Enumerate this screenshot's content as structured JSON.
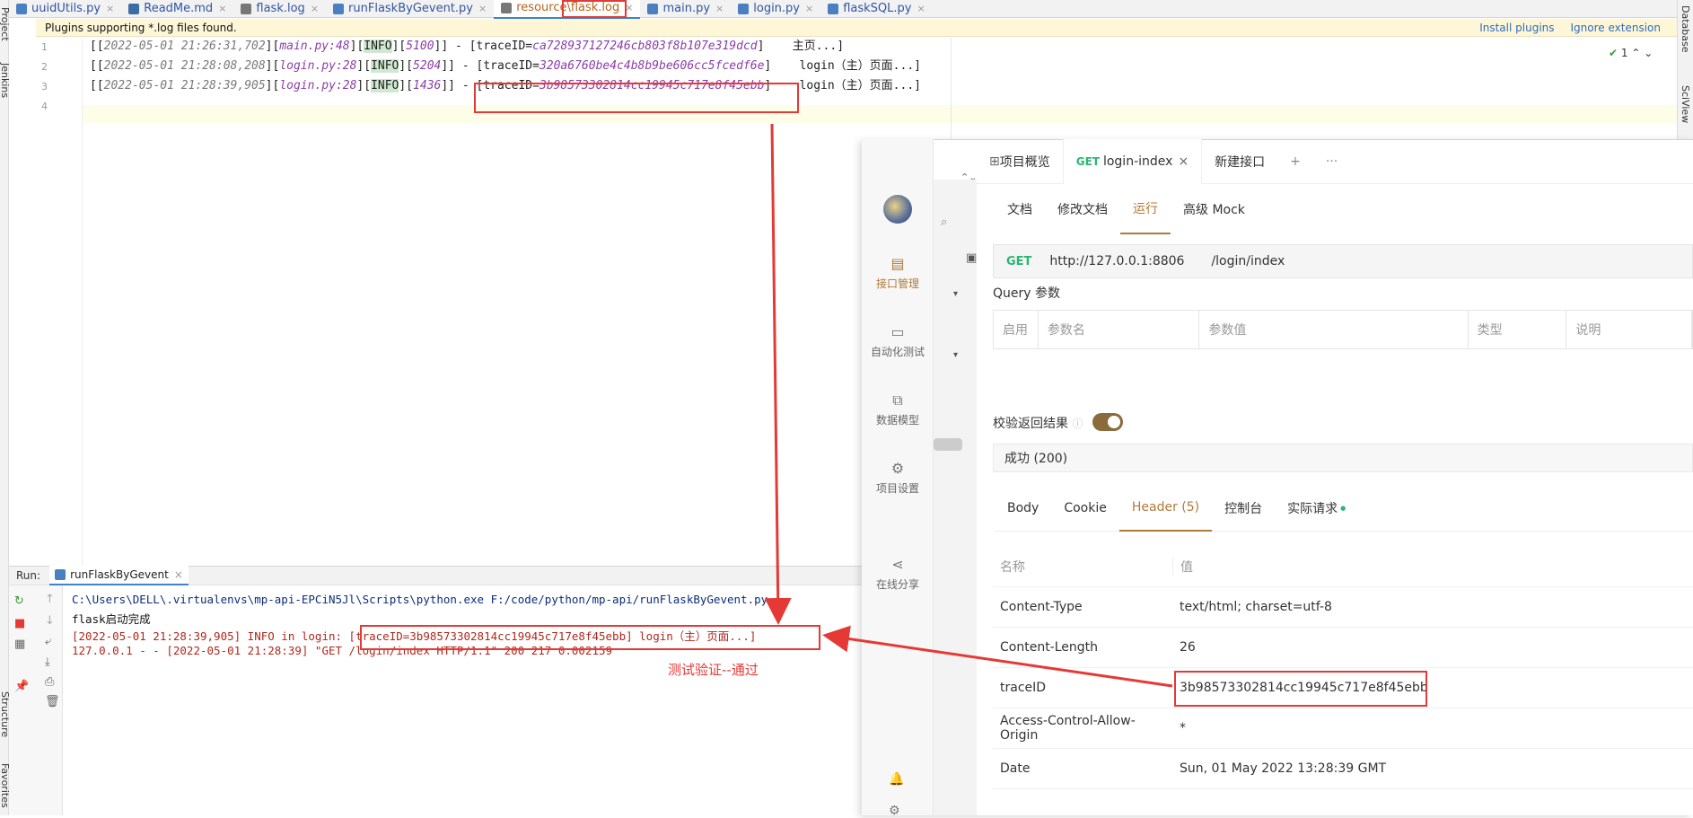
{
  "ide": {
    "tabs": [
      {
        "label": "uuidUtils.py",
        "color": "#4a7fc1",
        "active": false
      },
      {
        "label": "ReadMe.md",
        "color": "#3a6ea5",
        "active": false
      },
      {
        "label": "flask.log",
        "color": "#777777",
        "active": false
      },
      {
        "label": "runFlaskByGevent.py",
        "color": "#4a7fc1",
        "active": false
      },
      {
        "label": "resource\\flask.log",
        "color": "#777777",
        "active": true
      },
      {
        "label": "main.py",
        "color": "#4a7fc1",
        "active": false
      },
      {
        "label": "login.py",
        "color": "#4a7fc1",
        "active": false
      },
      {
        "label": "flaskSQL.py",
        "color": "#4a7fc1",
        "active": false
      }
    ],
    "banner": {
      "text": "Plugins supporting *.log files found.",
      "install": "Install plugins",
      "ignore": "Ignore extension"
    },
    "side_labels": {
      "project": "Project",
      "jenkins": "Jenkins",
      "structure": "Structure",
      "favorites": "Favorites",
      "database": "Database",
      "sciview": "SciView"
    },
    "highlight_count": "1",
    "line_numbers": [
      "1",
      "2",
      "3",
      "4"
    ],
    "log_lines": [
      {
        "open": "[[",
        "ts": "2022-05-01 21:26:31,702",
        "src": "main.py:48",
        "level": "INFO",
        "pid": "5100",
        "trace": "ca728937127246cb803f8b107e319dcd",
        "msg": "主页...]"
      },
      {
        "open": "[[",
        "ts": "2022-05-01 21:28:08,208",
        "src": "login.py:28",
        "level": "INFO",
        "pid": "5204",
        "trace": "320a6760be4c4b8b9be606cc5fcedf6e",
        "msg": "login（主）页面...]"
      },
      {
        "open": "[[",
        "ts": "2022-05-01 21:28:39,905",
        "src": "login.py:28",
        "level": "INFO",
        "pid": "1436",
        "trace": "3b98573302814cc19945c717e8f45ebb",
        "msg": "login（主）页面...]"
      }
    ],
    "run": {
      "label": "Run:",
      "tab": "runFlaskByGevent",
      "lines": [
        {
          "text": "C:\\Users\\DELL\\.virtualenvs\\mp-api-EPCiN5Jl\\Scripts\\python.exe F:/code/python/mp-api/runFlaskByGevent.py",
          "color": "#0b2d7a"
        },
        {
          "text": "flask启动完成",
          "color": "#111111"
        },
        {
          "text": "[2022-05-01 21:28:39,905] INFO in login: [traceID=3b98573302814cc19945c717e8f45ebb] login（主）页面...]",
          "color": "#b0281c"
        },
        {
          "text": "127.0.0.1 - - [2022-05-01 21:28:39] \"GET /login/index HTTP/1.1\" 200 217 0.002159",
          "color": "#b0281c"
        }
      ]
    },
    "annotation": "测试验证--通过"
  },
  "api_tool": {
    "top_tabs": [
      {
        "label": "项目概览"
      },
      {
        "method": "GET",
        "label": "login-index",
        "active": true
      },
      {
        "label": "新建接口"
      }
    ],
    "sidebar": [
      {
        "label": "接口管理",
        "icon": "folder-icon",
        "active": true
      },
      {
        "label": "自动化测试",
        "icon": "test-icon",
        "active": false
      },
      {
        "label": "数据模型",
        "icon": "model-icon",
        "active": false
      },
      {
        "label": "项目设置",
        "icon": "settings-icon",
        "active": false
      },
      {
        "label": "在线分享",
        "icon": "share-icon",
        "active": false
      }
    ],
    "sub_tabs": [
      "文档",
      "修改文档",
      "运行",
      "高级 Mock"
    ],
    "active_sub_tab": "运行",
    "request": {
      "method": "GET",
      "host": "http://127.0.0.1:8806",
      "path": "/login/index"
    },
    "query_label": "Query 参数",
    "param_columns": [
      "启用",
      "参数名",
      "参数值",
      "类型",
      "说明"
    ],
    "validate_label": "校验返回结果",
    "validate_on": true,
    "status": "成功 (200)",
    "response_tabs": [
      "Body",
      "Cookie",
      "Header (5)",
      "控制台",
      "实际请求"
    ],
    "active_response_tab": "Header (5)",
    "header_columns": {
      "name": "名称",
      "value": "值"
    },
    "headers": [
      {
        "name": "Content-Type",
        "value": "text/html; charset=utf-8"
      },
      {
        "name": "Content-Length",
        "value": "26"
      },
      {
        "name": "traceID",
        "value": "3b98573302814cc19945c717e8f45ebb"
      },
      {
        "name": "Access-Control-Allow-Origin",
        "value": "*"
      },
      {
        "name": "Date",
        "value": "Sun, 01 May 2022 13:28:39 GMT"
      }
    ]
  },
  "colors": {
    "annotation_red": "#e53935",
    "accent": "#b07a3a",
    "get_green": "#2bb673"
  }
}
